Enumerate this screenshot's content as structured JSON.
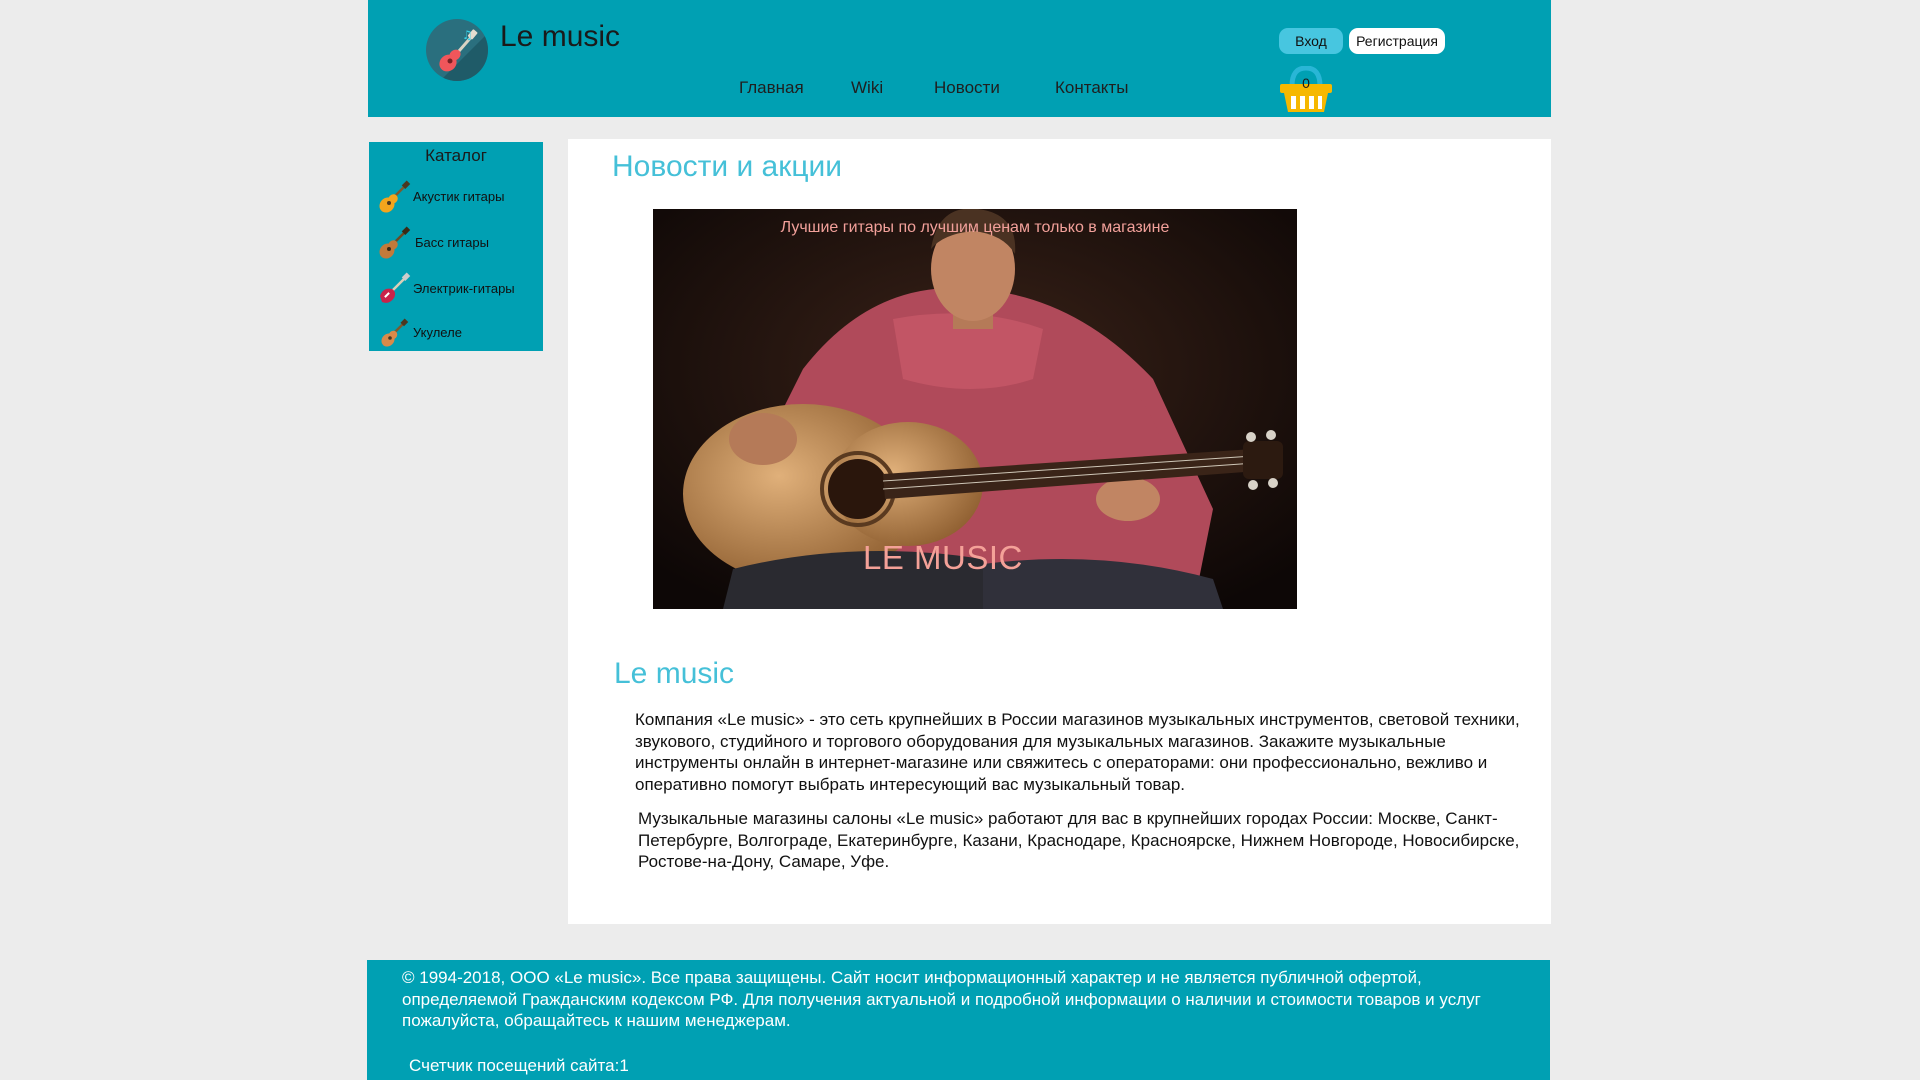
{
  "header": {
    "site_title": "Le music",
    "logo_icon": "guitar-logo-icon",
    "nav": [
      {
        "label": "Главная"
      },
      {
        "label": "Wiki"
      },
      {
        "label": "Новости"
      },
      {
        "label": "Контакты"
      }
    ],
    "login_label": "Вход",
    "register_label": "Регистрация",
    "basket_icon": "basket-icon",
    "basket_count": "0"
  },
  "sidebar": {
    "title": "Каталог",
    "items": [
      {
        "label": "Акустик гитары",
        "icon": "acoustic-guitar-icon"
      },
      {
        "label": "Басс гитары",
        "icon": "bass-guitar-icon"
      },
      {
        "label": "Электрик-гитары",
        "icon": "electric-guitar-icon"
      },
      {
        "label": "Укулеле",
        "icon": "ukulele-icon"
      }
    ]
  },
  "main": {
    "news_title": "Новости и акции",
    "promo_caption": "Лучшие гитары по лучшим ценам только в магазине",
    "promo_brand": "LE MUSIC",
    "about_title": "Le music",
    "paragraphs": [
      "Компания «Le music» - это сеть крупнейших в России магазинов музыкальных инструментов, световой техники, звукового, студийного и торгового оборудования для музыкальных магазинов. Закажите музыкальные инструменты онлайн в интернет-магазине или свяжитесь с операторами: они профессионально, вежливо и оперативно помогут выбрать интересующий вас музыкальный товар.",
      "Музыкальные магазины салоны «Le music» работают для вас в крупнейших городах России: Москве, Санкт-Петербурге, Волгограде, Екатеринбурге, Казани, Краснодаре, Красноярске, Нижнем Новгороде, Новосибирске, Ростове-на-Дону, Самаре, Уфе."
    ]
  },
  "footer": {
    "copyright": "© 1994-2018, ООО «Le music». Все права защищены. Сайт носит информационный характер и не является публичной офертой, определяемой Гражданским кодексом РФ. Для получения актуальной и подробной информации о наличии и стоимости товаров и услуг пожалуйста, обращайтесь к нашим менеджерам.",
    "counter": "Счетчик посещений сайта:1"
  },
  "colors": {
    "brand": "#00a0b3",
    "heading": "#45c0d8",
    "page_bg": "#ececec"
  }
}
